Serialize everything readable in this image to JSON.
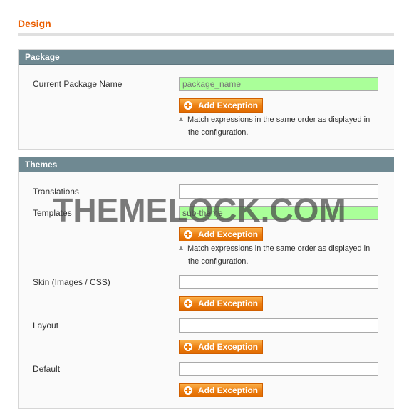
{
  "page": {
    "title": "Design"
  },
  "package_section": {
    "title": "Package",
    "fields": {
      "current_package_name": {
        "label": "Current Package Name",
        "placeholder": "package_name",
        "value": ""
      }
    },
    "add_exception_label": "Add Exception",
    "note_line1": "Match expressions in the same order as displayed in",
    "note_line2": "the configuration."
  },
  "themes_section": {
    "title": "Themes",
    "translations": {
      "label": "Translations",
      "value": ""
    },
    "templates": {
      "label": "Templates",
      "value": "sub-theme",
      "add_exception_label": "Add Exception",
      "note_line1": "Match expressions in the same order as displayed in",
      "note_line2": "the configuration."
    },
    "skin": {
      "label": "Skin (Images / CSS)",
      "value": "",
      "add_exception_label": "Add Exception"
    },
    "layout": {
      "label": "Layout",
      "value": "",
      "add_exception_label": "Add Exception"
    },
    "default": {
      "label": "Default",
      "value": "",
      "add_exception_label": "Add Exception"
    }
  },
  "watermark": {
    "text": "THEMELOCK.COM"
  },
  "colors": {
    "title_orange": "#eb5e00",
    "section_header": "#6f8992",
    "highlight_input": "#aaff99",
    "button_orange": "#ec7d10"
  },
  "icons": {
    "add_button_icon": "plus-circle-icon",
    "note_icon": "triangle-up-icon"
  }
}
